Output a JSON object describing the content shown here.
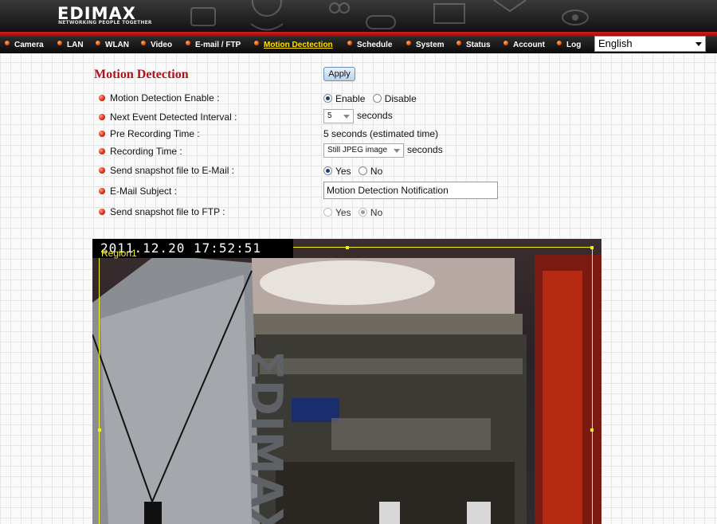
{
  "brand": {
    "logo": "EDIMAX",
    "tagline": "NETWORKING PEOPLE TOGETHER"
  },
  "nav": {
    "items": [
      {
        "label": "Camera"
      },
      {
        "label": "LAN"
      },
      {
        "label": "WLAN"
      },
      {
        "label": "Video"
      },
      {
        "label": "E-mail / FTP"
      },
      {
        "label": "Motion Dectection"
      },
      {
        "label": "Schedule"
      },
      {
        "label": "System"
      },
      {
        "label": "Status"
      },
      {
        "label": "Account"
      },
      {
        "label": "Log"
      }
    ],
    "active": "Motion Dectection"
  },
  "language": {
    "selected": "English"
  },
  "form": {
    "title": "Motion Detection",
    "apply_label": "Apply",
    "rows": {
      "enable": {
        "label": "Motion Detection Enable :",
        "opt_yes": "Enable",
        "opt_no": "Disable",
        "selected": "Enable"
      },
      "interval": {
        "label": "Next Event Detected Interval :",
        "value": "5",
        "unit": "seconds"
      },
      "pre_recording": {
        "label": "Pre Recording Time :",
        "value": "5 seconds (estimated time)"
      },
      "recording": {
        "label": "Recording Time :",
        "value": "Still JPEG image",
        "unit": "seconds"
      },
      "snapshot_email": {
        "label": "Send snapshot file to E-Mail :",
        "opt_yes": "Yes",
        "opt_no": "No",
        "selected": "Yes"
      },
      "email_subject": {
        "label": "E-Mail Subject :",
        "value": "Motion Detection Notification"
      },
      "snapshot_ftp": {
        "label": "Send snapshot file to FTP :",
        "opt_yes": "Yes",
        "opt_no": "No",
        "selected": "No"
      }
    }
  },
  "camera": {
    "timestamp": "2011.12.20 17:52:51",
    "region_label": "Region1"
  }
}
